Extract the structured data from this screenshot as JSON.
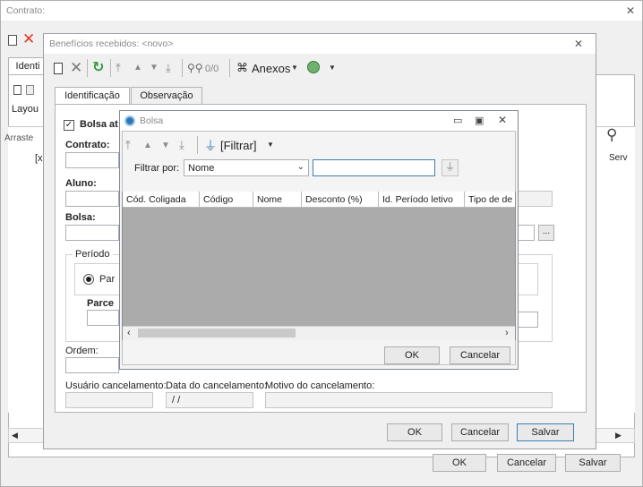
{
  "main_window": {
    "title": "Contrato:",
    "tabs": [
      "Identi"
    ],
    "sub_labels": {
      "layout": "Layou",
      "arraste": "Arraste",
      "x_col": "[x",
      "serv_col": "Serv"
    },
    "buttons": {
      "ok": "OK",
      "cancel": "Cancelar",
      "save": "Salvar"
    }
  },
  "beneficios_window": {
    "title": "Benefícios recebidos: <novo>",
    "toolbar": {
      "record_count": "0/0",
      "anexos_label": "Anexos"
    },
    "tabs": [
      "Identificação",
      "Observação"
    ],
    "form": {
      "bolsa_ativa_label": "Bolsa at",
      "contrato_label": "Contrato:",
      "aluno_label": "Aluno:",
      "bolsa_label": "Bolsa:",
      "periodo_group_label": "Período",
      "parcela_radio_label": "Par",
      "parcela_label": "Parce",
      "ordem_label": "Ordem:",
      "usuario_cancelamento_label": "Usuário cancelamento:",
      "data_cancelamento_label": "Data do cancelamento:",
      "data_cancelamento_value": "/ /",
      "motivo_cancelamento_label": "Motivo do cancelamento:",
      "browse_button": "..."
    },
    "buttons": {
      "ok": "OK",
      "cancel": "Cancelar",
      "save": "Salvar"
    }
  },
  "bolsa_dialog": {
    "title": "Bolsa",
    "filter_button": "[Filtrar]",
    "filter_by_label": "Filtrar por:",
    "filter_by_value": "Nome",
    "filter_text_value": "",
    "grid_columns": [
      "Cód. Coligada",
      "Código",
      "Nome",
      "Desconto (%)",
      "Id. Período letivo",
      "Tipo de de"
    ],
    "buttons": {
      "ok": "OK",
      "cancel": "Cancelar"
    }
  },
  "colors": {
    "accent": "#3c7fb1",
    "grid_body": "#ababab",
    "delete_red": "#e0392b",
    "refresh_green": "#2e9a3c"
  }
}
